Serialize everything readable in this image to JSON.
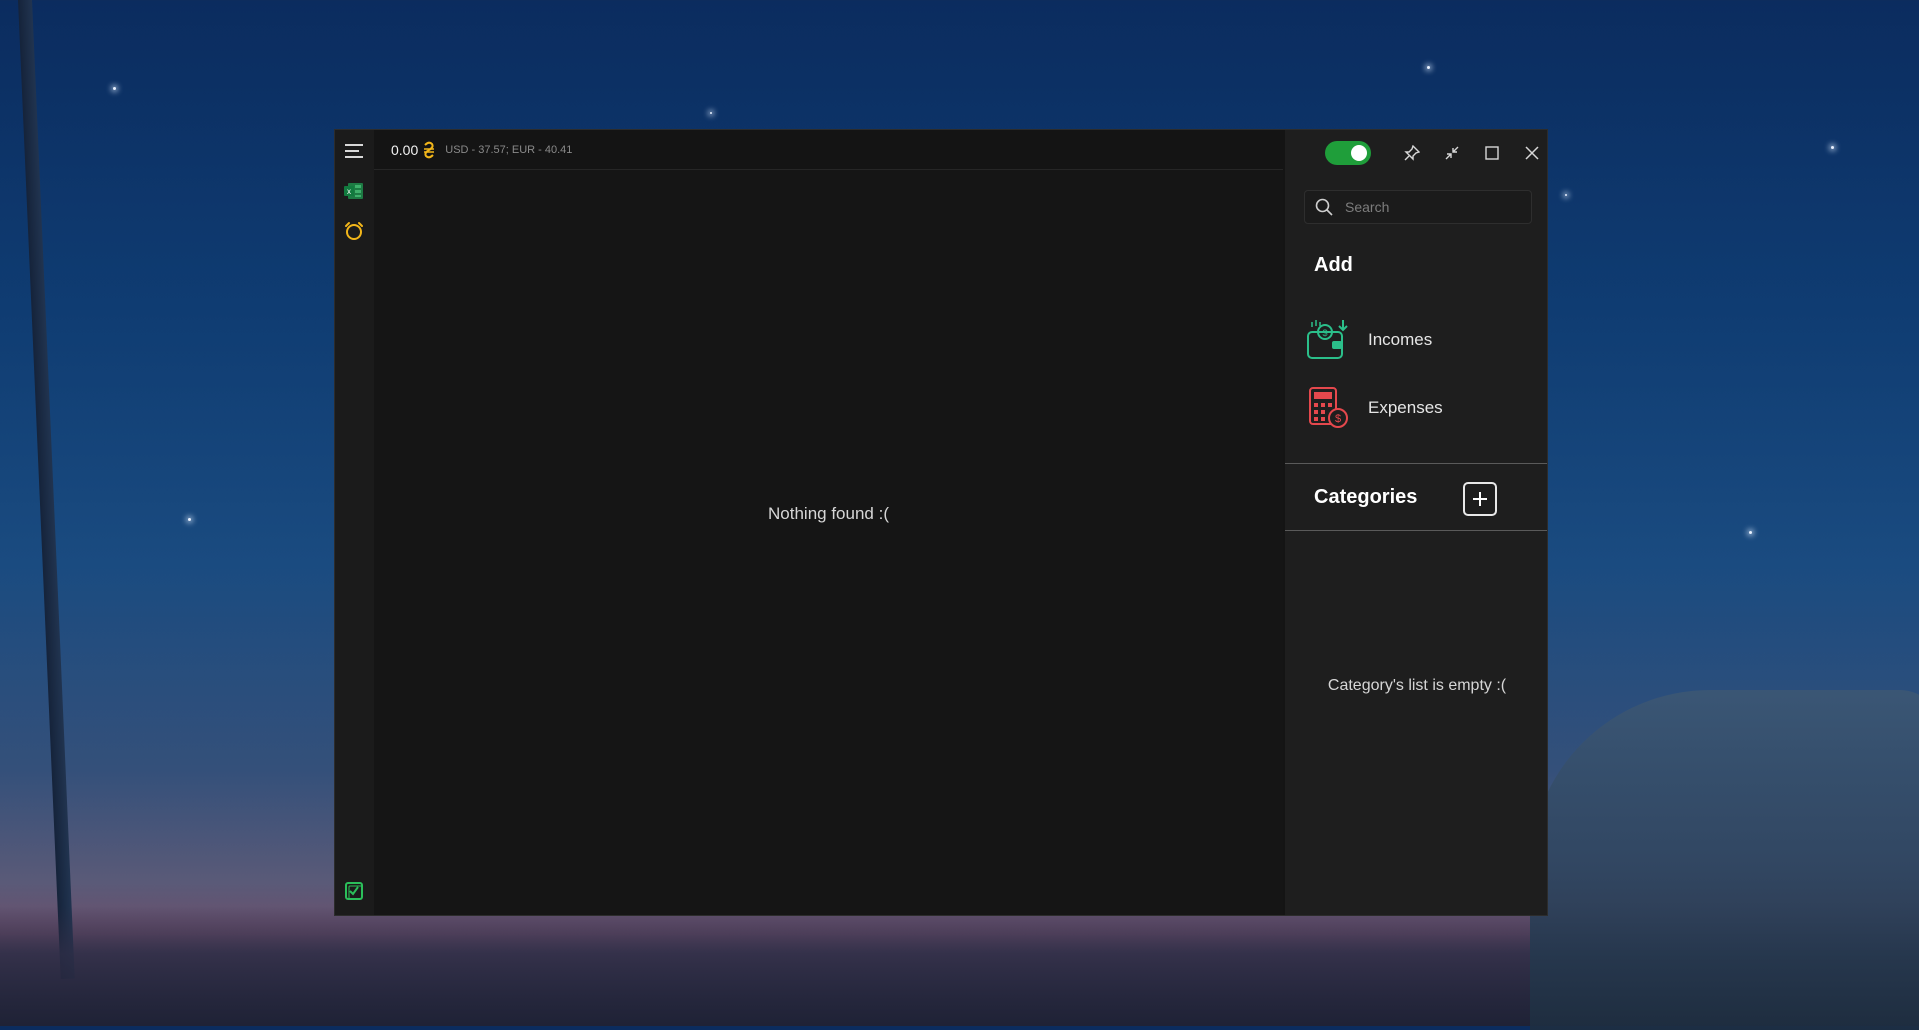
{
  "topbar": {
    "balance": "0.00",
    "rates": "USD - 37.57; EUR - 40.41"
  },
  "main": {
    "empty_message": "Nothing found :("
  },
  "search": {
    "placeholder": "Search"
  },
  "add_section": {
    "title": "Add",
    "items": [
      {
        "label": "Incomes",
        "icon": "wallet-income-icon"
      },
      {
        "label": "Expenses",
        "icon": "calculator-expense-icon"
      }
    ]
  },
  "categories": {
    "title": "Categories",
    "empty_message": "Category's list is empty :("
  },
  "colors": {
    "accent_green": "#1f9e3a",
    "currency_yellow": "#f2b61a",
    "income_green": "#2bbf8a",
    "expense_red": "#e5484d"
  }
}
